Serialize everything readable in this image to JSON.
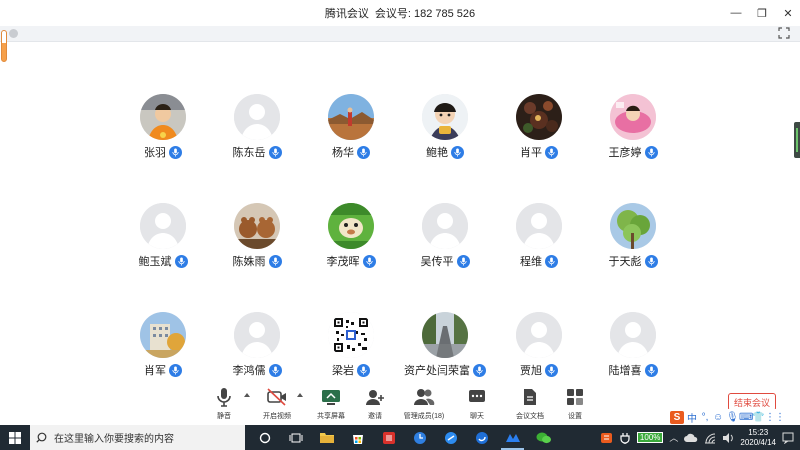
{
  "window": {
    "app_name": "腾讯会议",
    "meeting_label": "会议号:",
    "meeting_id": "182 785 526",
    "controls": {
      "minimize": "—",
      "restore": "❐",
      "close": "✕"
    }
  },
  "participants": [
    {
      "name": "张羽",
      "avatar": "photo-child-orange"
    },
    {
      "name": "陈东岳",
      "avatar": "default"
    },
    {
      "name": "杨华",
      "avatar": "photo-desert"
    },
    {
      "name": "鲍艳",
      "avatar": "photo-child-snack"
    },
    {
      "name": "肖平",
      "avatar": "photo-flowers-dark"
    },
    {
      "name": "王彦婷",
      "avatar": "photo-pink"
    },
    {
      "name": "鲍玉斌",
      "avatar": "default"
    },
    {
      "name": "陈姝雨",
      "avatar": "photo-bears"
    },
    {
      "name": "李茂晖",
      "avatar": "photo-green-animal"
    },
    {
      "name": "吴传平",
      "avatar": "default"
    },
    {
      "name": "程维",
      "avatar": "default"
    },
    {
      "name": "于天彪",
      "avatar": "photo-tree"
    },
    {
      "name": "肖军",
      "avatar": "photo-building"
    },
    {
      "name": "李鸿儒",
      "avatar": "default"
    },
    {
      "name": "梁岩",
      "avatar": "qr-code"
    },
    {
      "name": "资产处闫荣富",
      "avatar": "photo-road"
    },
    {
      "name": "贾旭",
      "avatar": "default"
    },
    {
      "name": "陆增喜",
      "avatar": "default"
    }
  ],
  "toolbar": {
    "mute": "静音",
    "video": "开启视频",
    "share": "共享屏幕",
    "invite": "邀请",
    "members": "管理成员(18)",
    "chat": "聊天",
    "docs": "会议文档",
    "settings": "设置",
    "end": "结束会议"
  },
  "ime": {
    "lang": "中"
  },
  "taskbar": {
    "search_placeholder": "在这里输入你要搜索的内容",
    "battery": "100%",
    "time": "15:23",
    "date": "2020/4/14"
  },
  "colors": {
    "mic_blue": "#2e7de6",
    "end_red": "#e04a3f",
    "taskbar": "#202a33"
  }
}
